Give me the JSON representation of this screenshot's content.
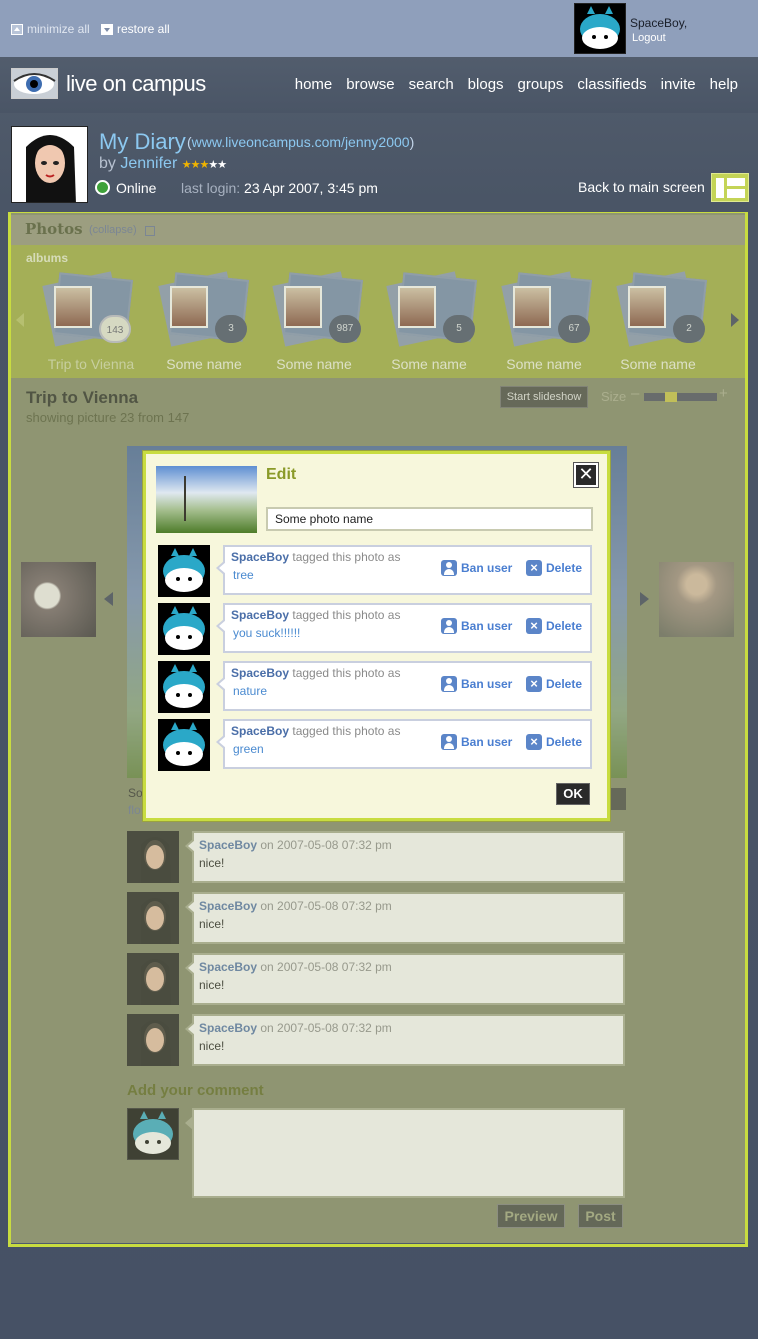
{
  "topbar": {
    "minimize_label": "minimize all",
    "restore_label": "restore all",
    "user_name": "SpaceBoy,",
    "logout_label": "Logout"
  },
  "nav": {
    "logo_text": "live on campus",
    "links": [
      "home",
      "browse",
      "search",
      "blogs",
      "groups",
      "classifieds",
      "invite",
      "help"
    ]
  },
  "profile": {
    "diary_title": "My Diary",
    "url_open": "(",
    "url": "www.liveoncampus.com/jenny2000",
    "url_close": ")",
    "by_prefix": "by",
    "author": "Jennifer",
    "stars_on": "★★★",
    "stars_off": "★★",
    "status": "Online",
    "last_login_label": "last login:",
    "last_login_value": "23 Apr 2007, 3:45 pm",
    "back_label": "Back to main screen"
  },
  "photos": {
    "heading": "Photos",
    "collapse_label": "(collapse)",
    "albums_heading": "albums",
    "albums": [
      {
        "name": "Trip to Vienna",
        "count": "143"
      },
      {
        "name": "Some name",
        "count": "3"
      },
      {
        "name": "Some name",
        "count": "987"
      },
      {
        "name": "Some name",
        "count": "5"
      },
      {
        "name": "Some name",
        "count": "67"
      },
      {
        "name": "Some name",
        "count": "2"
      }
    ],
    "album_title": "Trip to Vienna",
    "showing": "showing picture 23 from 147",
    "slideshow_label": "Start slideshow",
    "size_label": "Size",
    "size_minus": "–",
    "size_plus": "+",
    "size_level": 0.35,
    "under_photo_text": "So",
    "under_photo_link": "flo"
  },
  "comments": [
    {
      "user": "SpaceBoy",
      "meta": "on 2007-05-08 07:32 pm",
      "text": "nice!"
    },
    {
      "user": "SpaceBoy",
      "meta": "on 2007-05-08 07:32 pm",
      "text": "nice!"
    },
    {
      "user": "SpaceBoy",
      "meta": "on 2007-05-08 07:32 pm",
      "text": "nice!"
    },
    {
      "user": "SpaceBoy",
      "meta": "on 2007-05-08 07:32 pm",
      "text": "nice!"
    }
  ],
  "add_comment": {
    "heading": "Add your comment",
    "preview_label": "Preview",
    "post_label": "Post"
  },
  "modal": {
    "title": "Edit",
    "close_glyph": "✕",
    "photo_name": "Some photo name",
    "tags": [
      {
        "user": "SpaceBoy",
        "action": "tagged this photo as",
        "tag": "tree"
      },
      {
        "user": "SpaceBoy",
        "action": "tagged this photo as",
        "tag": "you suck!!!!!!"
      },
      {
        "user": "SpaceBoy",
        "action": "tagged this photo as",
        "tag": "nature"
      },
      {
        "user": "SpaceBoy",
        "action": "tagged this photo as",
        "tag": "green"
      }
    ],
    "ban_label": "Ban user",
    "delete_label": "Delete",
    "ok_label": "OK"
  },
  "colors": {
    "accent": "#c8dc40",
    "link": "#4a6ea8",
    "album_bar": "#9ca936"
  }
}
